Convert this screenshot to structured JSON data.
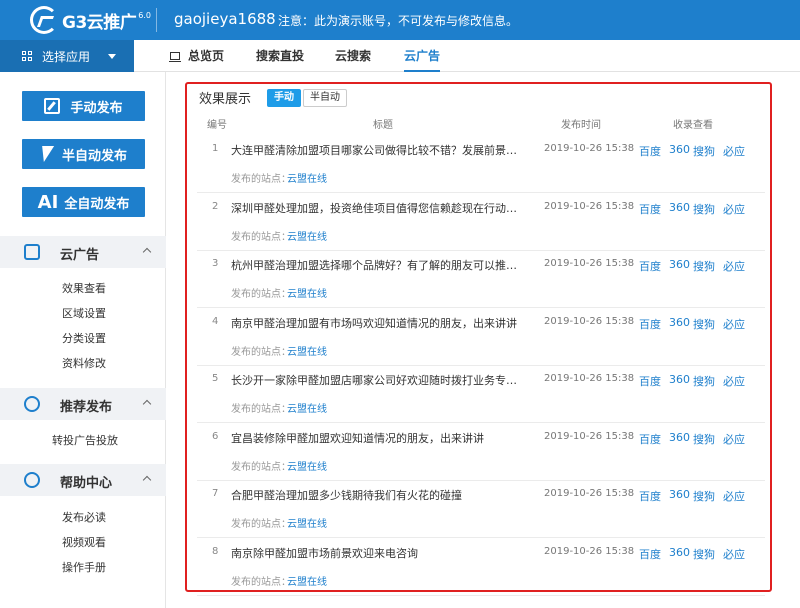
{
  "header": {
    "logo_text": "G3云推广",
    "logo_version": "6.0",
    "account": "gaojieya1688",
    "notice": "注意：此为演示账号，不可发布与修改信息。"
  },
  "appbar": {
    "label": "选择应用"
  },
  "tabs": [
    {
      "label": "总览页"
    },
    {
      "label": "搜索直投"
    },
    {
      "label": "云搜索"
    },
    {
      "label": "云广告"
    }
  ],
  "sidebar": {
    "buttons": [
      {
        "label": "手动发布"
      },
      {
        "label": "半自动发布"
      },
      {
        "icon_text": "AI",
        "label": "全自动发布"
      }
    ],
    "sections": [
      {
        "label": "云广告",
        "items": [
          "效果查看",
          "区域设置",
          "分类设置",
          "资料修改"
        ]
      },
      {
        "label": "推荐发布",
        "items": [
          "转投广告投放"
        ]
      },
      {
        "label": "帮助中心",
        "items": [
          "发布必读",
          "视频观看",
          "操作手册"
        ]
      }
    ]
  },
  "panel": {
    "title": "效果展示",
    "mode_on": "手动",
    "mode_off": "半自动",
    "columns": [
      "编号",
      "标题",
      "发布时间",
      "收录查看"
    ],
    "site_label": "发布的站点：",
    "engines": [
      "百度",
      "360",
      "搜狗",
      "必应"
    ],
    "rows": [
      {
        "num": "1",
        "title": "大连甲醛清除加盟项目哪家公司做得比较不错？发展前景怎...",
        "time": "2019-10-26 15:38",
        "site": "云盟在线"
      },
      {
        "num": "2",
        "title": "深圳甲醛处理加盟，投资绝佳项目值得您信赖趁现在行动吧...",
        "time": "2019-10-26 15:38",
        "site": "云盟在线"
      },
      {
        "num": "3",
        "title": "杭州甲醛治理加盟选择哪个品牌好？有了解的朋友可以推荐...",
        "time": "2019-10-26 15:38",
        "site": "云盟在线"
      },
      {
        "num": "4",
        "title": "南京甲醛治理加盟有市场吗欢迎知道情况的朋友，出来讲讲",
        "time": "2019-10-26 15:38",
        "site": "云盟在线"
      },
      {
        "num": "5",
        "title": "长沙开一家除甲醛加盟店哪家公司好欢迎随时拨打业务专线...",
        "time": "2019-10-26 15:38",
        "site": "云盟在线"
      },
      {
        "num": "6",
        "title": "宜昌装修除甲醛加盟欢迎知道情况的朋友，出来讲讲",
        "time": "2019-10-26 15:38",
        "site": "云盟在线"
      },
      {
        "num": "7",
        "title": "合肥甲醛治理加盟多少钱期待我们有火花的碰撞",
        "time": "2019-10-26 15:38",
        "site": "云盟在线"
      },
      {
        "num": "8",
        "title": "南京除甲醛加盟市场前景欢迎来电咨询",
        "time": "2019-10-26 15:38",
        "site": "云盟在线"
      }
    ]
  }
}
